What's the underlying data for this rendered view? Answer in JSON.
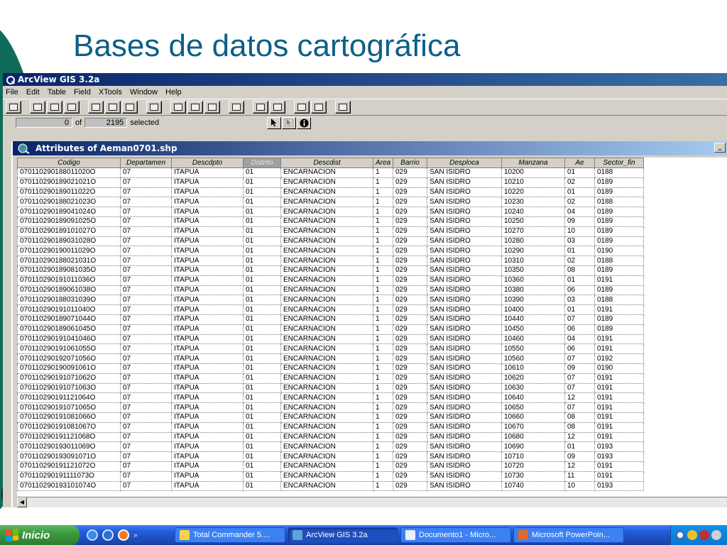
{
  "slide": {
    "title": "Bases de datos cartográfica",
    "stray_letter": "("
  },
  "arcview": {
    "window_title": "ArcView GIS 3.2a",
    "menu": [
      "File",
      "Edit",
      "Table",
      "Field",
      "XTools",
      "Window",
      "Help"
    ],
    "status": {
      "selected_count": "0",
      "of_label": "of",
      "total": "2195",
      "selected_label": "selected"
    },
    "table_title": "Attributes of Aeman0701.shp",
    "columns": [
      "Codigo",
      "Departamen",
      "Descdpto",
      "Distrito",
      "Descdist",
      "Area",
      "Barrio",
      "Desploca",
      "Manzana",
      "Ae",
      "Sector_fin"
    ],
    "selected_column": "Distrito",
    "rows": [
      [
        "070110290188011020O",
        "07",
        "ITAPUA",
        "01",
        "ENCARNACION",
        "1",
        "029",
        "SAN ISIDRO",
        "10200",
        "01",
        "0188"
      ],
      [
        "070110290189021021O",
        "07",
        "ITAPUA",
        "01",
        "ENCARNACION",
        "1",
        "029",
        "SAN ISIDRO",
        "10210",
        "02",
        "0189"
      ],
      [
        "070110290189011022O",
        "07",
        "ITAPUA",
        "01",
        "ENCARNACION",
        "1",
        "029",
        "SAN ISIDRO",
        "10220",
        "01",
        "0189"
      ],
      [
        "070110290188021023O",
        "07",
        "ITAPUA",
        "01",
        "ENCARNACION",
        "1",
        "029",
        "SAN ISIDRO",
        "10230",
        "02",
        "0188"
      ],
      [
        "070110290189041024O",
        "07",
        "ITAPUA",
        "01",
        "ENCARNACION",
        "1",
        "029",
        "SAN ISIDRO",
        "10240",
        "04",
        "0189"
      ],
      [
        "070110290189091025O",
        "07",
        "ITAPUA",
        "01",
        "ENCARNACION",
        "1",
        "029",
        "SAN ISIDRO",
        "10250",
        "09",
        "0189"
      ],
      [
        "070110290189101027O",
        "07",
        "ITAPUA",
        "01",
        "ENCARNACION",
        "1",
        "029",
        "SAN ISIDRO",
        "10270",
        "10",
        "0189"
      ],
      [
        "070110290189031028O",
        "07",
        "ITAPUA",
        "01",
        "ENCARNACION",
        "1",
        "029",
        "SAN ISIDRO",
        "10280",
        "03",
        "0189"
      ],
      [
        "070110290190011029O",
        "07",
        "ITAPUA",
        "01",
        "ENCARNACION",
        "1",
        "029",
        "SAN ISIDRO",
        "10290",
        "01",
        "0190"
      ],
      [
        "070110290188021031O",
        "07",
        "ITAPUA",
        "01",
        "ENCARNACION",
        "1",
        "029",
        "SAN ISIDRO",
        "10310",
        "02",
        "0188"
      ],
      [
        "070110290189081035O",
        "07",
        "ITAPUA",
        "01",
        "ENCARNACION",
        "1",
        "029",
        "SAN ISIDRO",
        "10350",
        "08",
        "0189"
      ],
      [
        "070110290191011036O",
        "07",
        "ITAPUA",
        "01",
        "ENCARNACION",
        "1",
        "029",
        "SAN ISIDRO",
        "10360",
        "01",
        "0191"
      ],
      [
        "070110290189061038O",
        "07",
        "ITAPUA",
        "01",
        "ENCARNACION",
        "1",
        "029",
        "SAN ISIDRO",
        "10380",
        "06",
        "0189"
      ],
      [
        "070110290188031039O",
        "07",
        "ITAPUA",
        "01",
        "ENCARNACION",
        "1",
        "029",
        "SAN ISIDRO",
        "10390",
        "03",
        "0188"
      ],
      [
        "070110290191011040O",
        "07",
        "ITAPUA",
        "01",
        "ENCARNACION",
        "1",
        "029",
        "SAN ISIDRO",
        "10400",
        "01",
        "0191"
      ],
      [
        "070110290189071044O",
        "07",
        "ITAPUA",
        "01",
        "ENCARNACION",
        "1",
        "029",
        "SAN ISIDRO",
        "10440",
        "07",
        "0189"
      ],
      [
        "070110290189061045O",
        "07",
        "ITAPUA",
        "01",
        "ENCARNACION",
        "1",
        "029",
        "SAN ISIDRO",
        "10450",
        "06",
        "0189"
      ],
      [
        "070110290191041046O",
        "07",
        "ITAPUA",
        "01",
        "ENCARNACION",
        "1",
        "029",
        "SAN ISIDRO",
        "10460",
        "04",
        "0191"
      ],
      [
        "070110290191061055O",
        "07",
        "ITAPUA",
        "01",
        "ENCARNACION",
        "1",
        "029",
        "SAN ISIDRO",
        "10550",
        "06",
        "0191"
      ],
      [
        "070110290192071056O",
        "07",
        "ITAPUA",
        "01",
        "ENCARNACION",
        "1",
        "029",
        "SAN ISIDRO",
        "10560",
        "07",
        "0192"
      ],
      [
        "070110290190091061O",
        "07",
        "ITAPUA",
        "01",
        "ENCARNACION",
        "1",
        "029",
        "SAN ISIDRO",
        "10610",
        "09",
        "0190"
      ],
      [
        "070110290191071062O",
        "07",
        "ITAPUA",
        "01",
        "ENCARNACION",
        "1",
        "029",
        "SAN ISIDRO",
        "10620",
        "07",
        "0191"
      ],
      [
        "070110290191071063O",
        "07",
        "ITAPUA",
        "01",
        "ENCARNACION",
        "1",
        "029",
        "SAN ISIDRO",
        "10630",
        "07",
        "0191"
      ],
      [
        "070110290191121064O",
        "07",
        "ITAPUA",
        "01",
        "ENCARNACION",
        "1",
        "029",
        "SAN ISIDRO",
        "10640",
        "12",
        "0191"
      ],
      [
        "070110290191071065O",
        "07",
        "ITAPUA",
        "01",
        "ENCARNACION",
        "1",
        "029",
        "SAN ISIDRO",
        "10650",
        "07",
        "0191"
      ],
      [
        "070110290191081066O",
        "07",
        "ITAPUA",
        "01",
        "ENCARNACION",
        "1",
        "029",
        "SAN ISIDRO",
        "10660",
        "08",
        "0191"
      ],
      [
        "070110290191081067O",
        "07",
        "ITAPUA",
        "01",
        "ENCARNACION",
        "1",
        "029",
        "SAN ISIDRO",
        "10670",
        "08",
        "0191"
      ],
      [
        "070110290191121068O",
        "07",
        "ITAPUA",
        "01",
        "ENCARNACION",
        "1",
        "029",
        "SAN ISIDRO",
        "10680",
        "12",
        "0191"
      ],
      [
        "070110290193011069O",
        "07",
        "ITAPUA",
        "01",
        "ENCARNACION",
        "1",
        "029",
        "SAN ISIDRO",
        "10690",
        "01",
        "0193"
      ],
      [
        "070110290193091071O",
        "07",
        "ITAPUA",
        "01",
        "ENCARNACION",
        "1",
        "029",
        "SAN ISIDRO",
        "10710",
        "09",
        "0193"
      ],
      [
        "070110290191121072O",
        "07",
        "ITAPUA",
        "01",
        "ENCARNACION",
        "1",
        "029",
        "SAN ISIDRO",
        "10720",
        "12",
        "0191"
      ],
      [
        "070110290191111073O",
        "07",
        "ITAPUA",
        "01",
        "ENCARNACION",
        "1",
        "029",
        "SAN ISIDRO",
        "10730",
        "11",
        "0191"
      ],
      [
        "070110290193101074O",
        "07",
        "ITAPUA",
        "01",
        "ENCARNACION",
        "1",
        "029",
        "SAN ISIDRO",
        "10740",
        "10",
        "0193"
      ]
    ]
  },
  "taskbar": {
    "start_label": "Inicio",
    "tasks": [
      {
        "label": "Total Commander 5....",
        "icon": "total-commander-icon",
        "color": "#ffd24a"
      },
      {
        "label": "ArcView GIS 3.2a",
        "icon": "arcview-icon",
        "color": "#5fa3d6"
      },
      {
        "label": "Documento1 - Micro...",
        "icon": "word-icon",
        "color": "#e8f0ff"
      },
      {
        "label": "Microsoft PowerPoin...",
        "icon": "powerpoint-icon",
        "color": "#e2682a"
      }
    ]
  },
  "colors": {
    "title_color": "#0d5f86",
    "arc_color": "#0f6b5a",
    "taskbar_blue": "#245edb",
    "start_green": "#3c9a3f"
  }
}
